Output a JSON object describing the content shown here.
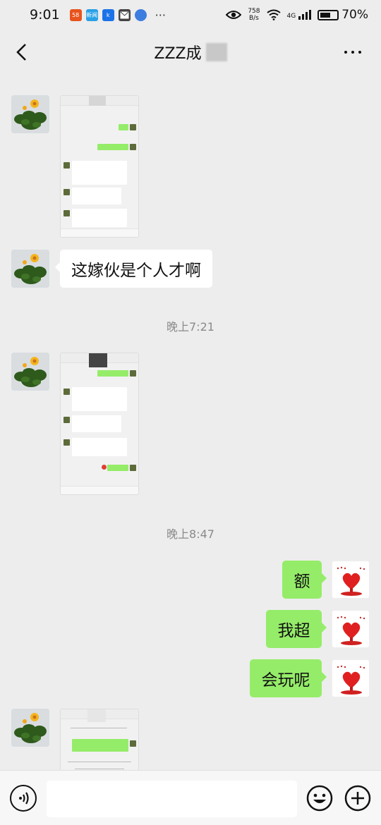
{
  "status_bar": {
    "time": "9:01",
    "apps": [
      {
        "name": "58-app-icon",
        "label": "58",
        "color": "#e8541e"
      },
      {
        "name": "news-app-icon",
        "label": "新闻",
        "color": "#2ba0e6"
      },
      {
        "name": "k-app-icon",
        "label": "k",
        "color": "#1b73e8"
      },
      {
        "name": "mail-app-icon",
        "label": "",
        "color": "#444444"
      },
      {
        "name": "browser-app-icon",
        "label": "",
        "color": "#3d7de0"
      }
    ],
    "overflow": "···",
    "net_speed_value": "758",
    "net_speed_unit": "B/s",
    "network": "4G",
    "battery": "70%",
    "battery_level": 0.7
  },
  "header": {
    "title": "ZZZ成"
  },
  "chat": {
    "text_message_1": "这嫁伙是个人才啊",
    "timestamp_1": "晚上7:21",
    "timestamp_2": "晚上8:47",
    "sent_messages": [
      "额",
      "我超",
      "会玩呢"
    ]
  },
  "colors": {
    "background": "#ededed",
    "sent_bubble": "#95ec69",
    "received_bubble": "#ffffff",
    "timestamp": "#8a8a8a"
  },
  "input_bar": {
    "value": ""
  }
}
